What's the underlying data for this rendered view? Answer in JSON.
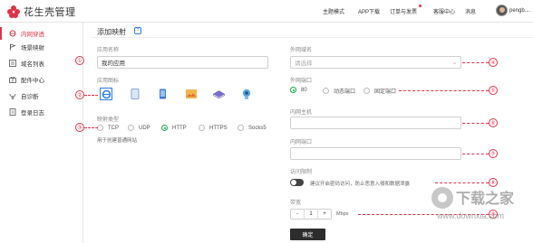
{
  "app": {
    "logo_text": "花生壳管理"
  },
  "topnav": {
    "items": [
      "主题模式",
      "APP下载",
      "订单与发票",
      "客服中心",
      "消息"
    ],
    "username": "pengb...."
  },
  "sidebar": {
    "items": [
      {
        "label": "内网穿透",
        "icon": "network-icon",
        "active": true
      },
      {
        "label": "场景映射",
        "icon": "flag-icon",
        "active": false
      },
      {
        "label": "域名列表",
        "icon": "list-icon",
        "active": false
      },
      {
        "label": "配件中心",
        "icon": "gift-icon",
        "active": false
      },
      {
        "label": "自诊断",
        "icon": "diagnose-icon",
        "active": false
      },
      {
        "label": "登录日志",
        "icon": "log-icon",
        "active": false
      }
    ]
  },
  "page": {
    "title": "添加映射",
    "help_icon_text": "?"
  },
  "form": {
    "app_name_label": "应用名称",
    "app_name_value": "我的应用",
    "app_icon_label": "应用图标",
    "map_type_label": "映射类型",
    "map_types": [
      "TCP",
      "UDP",
      "HTTP",
      "HTTPS",
      "Socks5"
    ],
    "map_type_selected": "HTTP",
    "map_type_note": "用于创建普通网站",
    "external_domain_label": "外网域名",
    "external_domain_placeholder": "请选择",
    "external_port_label": "外网端口",
    "external_port_options": [
      "80",
      "动态端口",
      "固定端口"
    ],
    "external_port_selected": "80",
    "internal_host_label": "内网主机",
    "internal_host_value": "",
    "internal_port_label": "内网端口",
    "internal_port_value": "",
    "access_limit_label": "访问限制",
    "access_limit_note": "建议开启密码访问，防止恶意入侵和数据泄露",
    "bandwidth_label": "带宽",
    "bandwidth_minus": "-",
    "bandwidth_value": "1",
    "bandwidth_plus": "+",
    "bandwidth_unit": "Mbps",
    "submit_label": "确定"
  },
  "callouts": [
    "①",
    "②",
    "③",
    "④",
    "⑤",
    "⑥",
    "⑦",
    "⑧",
    "⑨"
  ],
  "watermark": {
    "text": "下载之家",
    "url": "www.downxia.com"
  },
  "colors": {
    "accent": "#e0334a",
    "radio_checked": "#19a64a",
    "selected_icon_border": "#2b7de9"
  }
}
